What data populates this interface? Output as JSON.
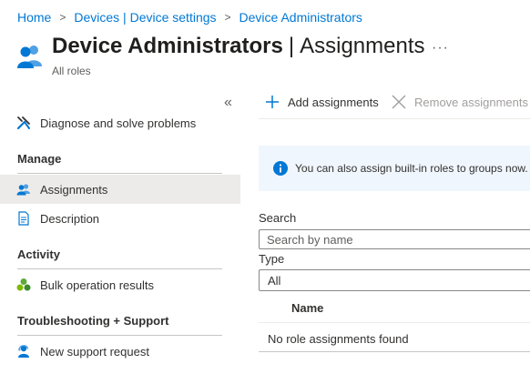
{
  "breadcrumb": {
    "items": [
      "Home",
      "Devices | Device settings",
      "Device Administrators"
    ],
    "separator": ">"
  },
  "header": {
    "title": "Device Administrators",
    "separator": "|",
    "section": "Assignments",
    "subtitle": "All roles",
    "more_label": "···",
    "icon": "role-users-icon"
  },
  "sidebar": {
    "collapse_label": "«",
    "top_item": {
      "label": "Diagnose and solve problems",
      "icon": "wrench-icon"
    },
    "sections": [
      {
        "title": "Manage",
        "items": [
          {
            "label": "Assignments",
            "icon": "users-icon",
            "selected": true
          },
          {
            "label": "Description",
            "icon": "document-icon",
            "selected": false
          }
        ]
      },
      {
        "title": "Activity",
        "items": [
          {
            "label": "Bulk operation results",
            "icon": "bulk-operations-icon",
            "selected": false
          }
        ]
      },
      {
        "title": "Troubleshooting + Support",
        "items": [
          {
            "label": "New support request",
            "icon": "support-person-icon",
            "selected": false
          }
        ]
      }
    ]
  },
  "toolbar": {
    "add_label": "Add assignments",
    "remove_label": "Remove assignments"
  },
  "banner": {
    "text": "You can also assign built-in roles to groups now.",
    "icon": "info-icon"
  },
  "filters": {
    "search_label": "Search",
    "search_placeholder": "Search by name",
    "type_label": "Type",
    "type_value": "All"
  },
  "table": {
    "columns": [
      "Name"
    ],
    "empty_message": "No role assignments found"
  },
  "colors": {
    "accent": "#0078d4",
    "selected_bg": "#edebe9",
    "banner_bg": "#f0f6fd",
    "bulk_icon_green": "#5ea938"
  }
}
